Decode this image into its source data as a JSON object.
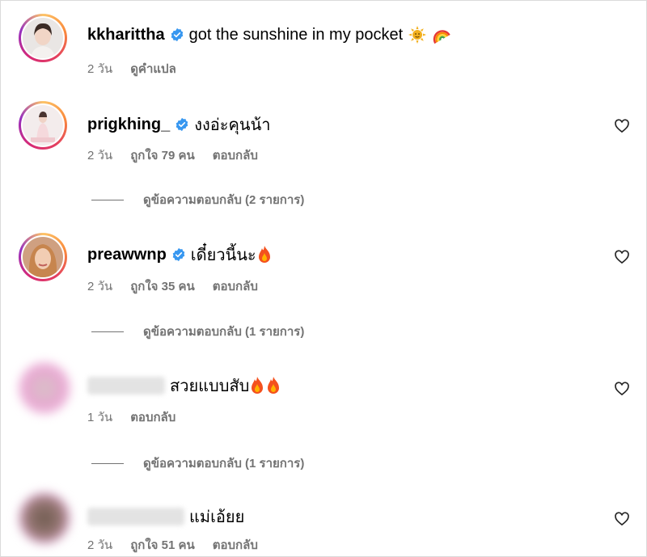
{
  "comments": [
    {
      "username": "kkharittha",
      "verified": true,
      "text": "got the sunshine in my pocket",
      "emoji": [
        "sun-emoji",
        "rainbow-emoji"
      ],
      "time": "2 วัน",
      "translate": "ดูคำแปล"
    },
    {
      "username": "prigkhing_",
      "verified": true,
      "text": "งงอ่ะคุนน้า",
      "time": "2 วัน",
      "likes": "ถูกใจ 79 คน",
      "reply": "ตอบกลับ",
      "view_replies": "ดูข้อความตอบกลับ (2 รายการ)"
    },
    {
      "username": "preawwnp",
      "verified": true,
      "text": "เดี๋ยวนี้นะ",
      "emoji": [
        "fire-emoji"
      ],
      "time": "2 วัน",
      "likes": "ถูกใจ 35 คน",
      "reply": "ตอบกลับ",
      "view_replies": "ดูข้อความตอบกลับ (1 รายการ)"
    },
    {
      "username": "",
      "verified": false,
      "text": "สวยแบบสับ",
      "emoji": [
        "fire-emoji",
        "fire-emoji"
      ],
      "time": "1 วัน",
      "reply": "ตอบกลับ",
      "view_replies": "ดูข้อความตอบกลับ (1 รายการ)"
    },
    {
      "username": "",
      "verified": false,
      "text": "แม่เอ้ยย",
      "time": "2 วัน",
      "likes": "ถูกใจ 51 คน",
      "reply": "ตอบกลับ"
    }
  ],
  "colors": {
    "verified": "#3797f0",
    "meta": "#737373",
    "border": "#dbdbdb"
  }
}
